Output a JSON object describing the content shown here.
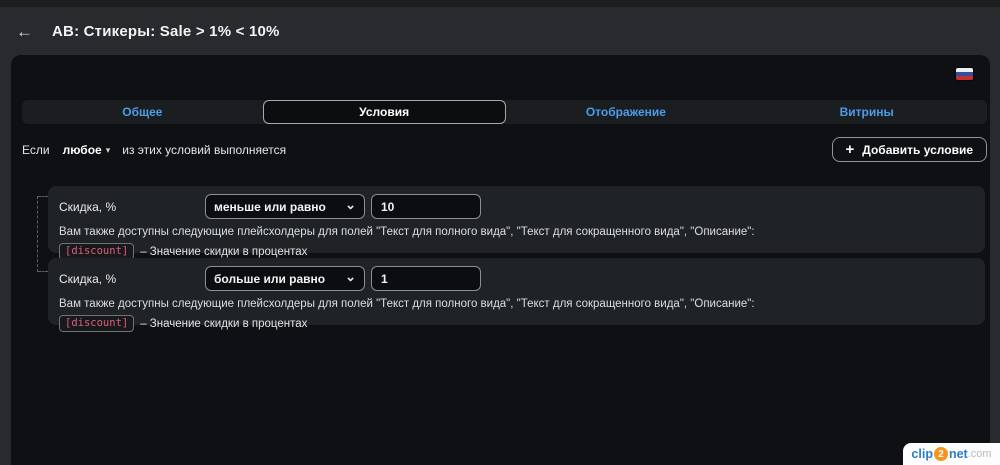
{
  "icons": {
    "back": "←",
    "caret_down": "▾",
    "chevron_down": "⌄",
    "plus": "+"
  },
  "header": {
    "title": "AB: Стикеры: Sale > 1% < 10%"
  },
  "panel": {
    "language_flag": "russian-flag",
    "tabs": [
      {
        "label": "Общее",
        "active": false
      },
      {
        "label": "Условия",
        "active": true
      },
      {
        "label": "Отображение",
        "active": false
      },
      {
        "label": "Витрины",
        "active": false
      }
    ],
    "condition_header": {
      "prefix": "Если",
      "mode_selected": "любое",
      "suffix": "из этих условий выполняется",
      "add_button_label": "Добавить условие"
    },
    "conditions": [
      {
        "field": "Скидка, %",
        "operator": "меньше или равно",
        "value": "10",
        "hint": "Вам также доступны следующие плейсхолдеры для полей \"Текст для полного вида\", \"Текст для сокращенного вида\", \"Описание\":",
        "placeholder_code": "[discount]",
        "placeholder_desc": "– Значение скидки в процентах"
      },
      {
        "field": "Скидка, %",
        "operator": "больше или равно",
        "value": "1",
        "hint": "Вам также доступны следующие плейсхолдеры для полей \"Текст для полного вида\", \"Текст для сокращенного вида\", \"Описание\":",
        "placeholder_code": "[discount]",
        "placeholder_desc": "– Значение скидки в процентах"
      }
    ]
  },
  "watermark": {
    "clip": "clip",
    "two": "2",
    "net": "net",
    "com": ".com"
  },
  "colors": {
    "accent_blue": "#4d9ce8",
    "chip_pink": "#dd5f76",
    "panel_bg": "#0e1013",
    "card_bg": "#202326",
    "flag_blue": "#32509e",
    "flag_red": "#c62f30",
    "watermark_orange": "#f7941e",
    "watermark_blue": "#2e7cc0"
  }
}
